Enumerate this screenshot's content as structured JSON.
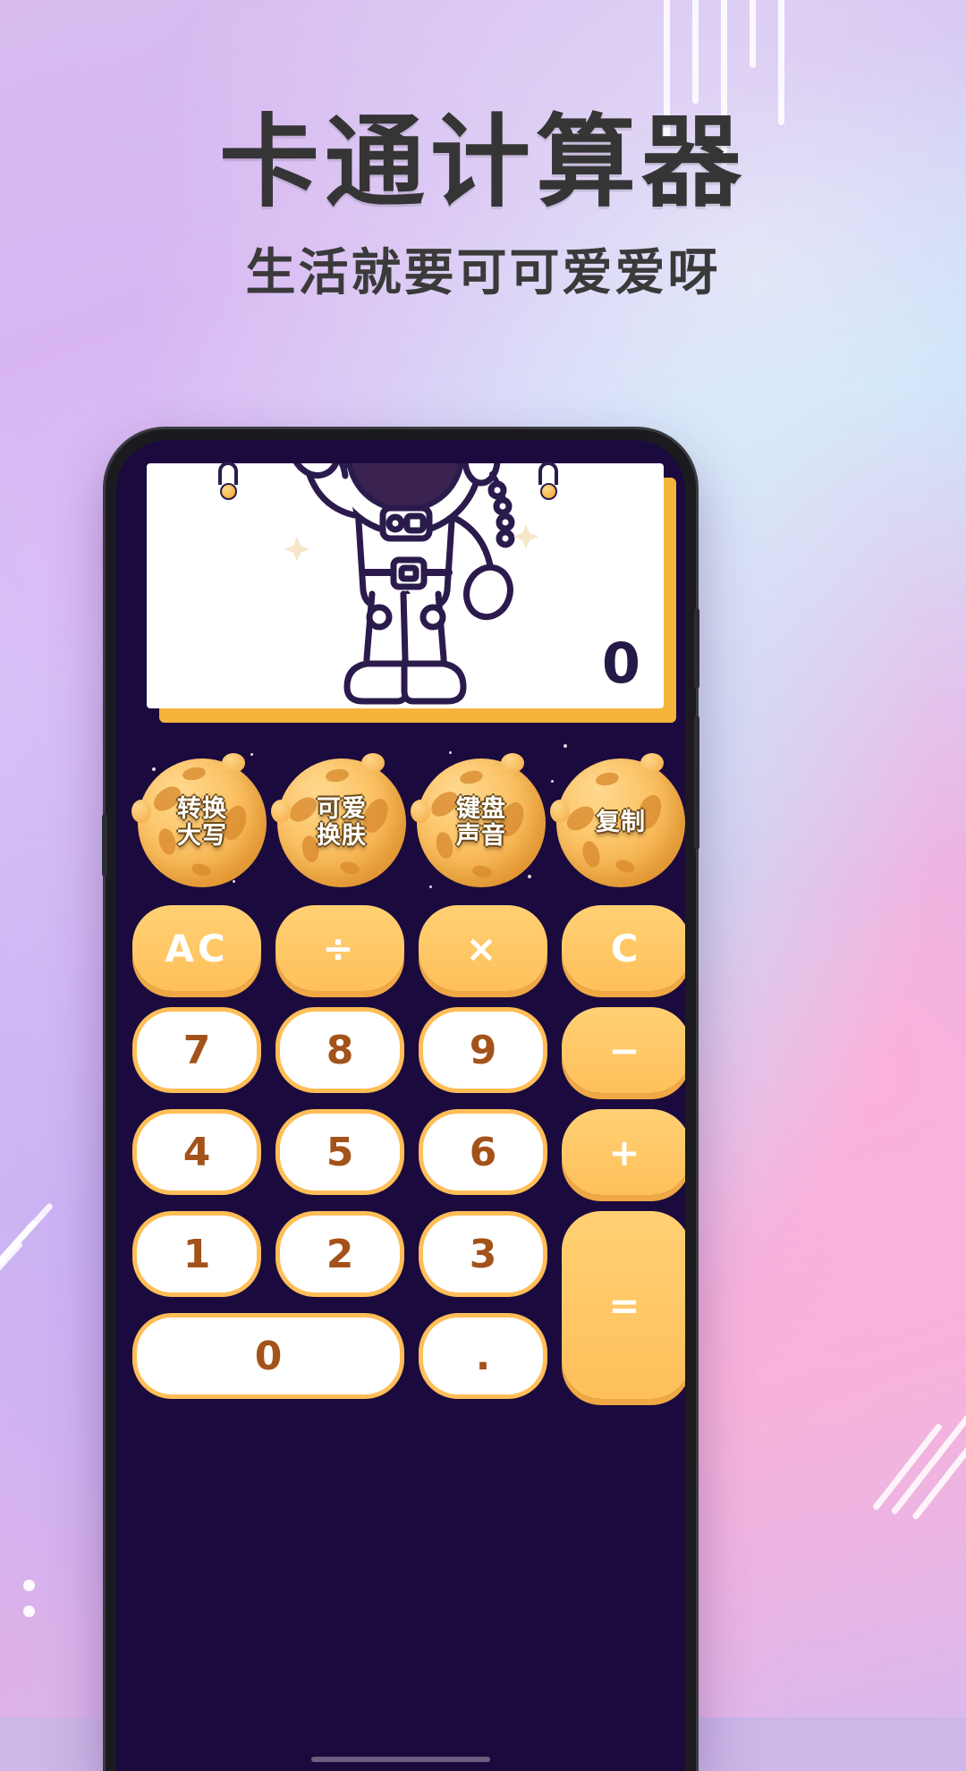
{
  "poster": {
    "title": "卡通计算器",
    "subtitle": "生活就要可可爱爱呀"
  },
  "app": {
    "display": {
      "value": "0"
    },
    "features": [
      {
        "name": "uppercase-convert",
        "line1": "转换",
        "line2": "大写"
      },
      {
        "name": "cute-skin",
        "line1": "可爱",
        "line2": "换肤"
      },
      {
        "name": "keyboard-sound",
        "line1": "键盘",
        "line2": "声音"
      },
      {
        "name": "copy",
        "line1": "复制",
        "line2": ""
      }
    ],
    "keys": {
      "ac": "AC",
      "divide": "÷",
      "multiply": "×",
      "clear": "C",
      "seven": "7",
      "eight": "8",
      "nine": "9",
      "minus": "−",
      "four": "4",
      "five": "5",
      "six": "6",
      "plus": "+",
      "one": "1",
      "two": "2",
      "three": "3",
      "equals": "=",
      "zero": "0",
      "dot": "."
    }
  },
  "colors": {
    "screen_bg": "#1b0a3d",
    "key_orange": "#ffc05b",
    "key_orange_shadow": "#f0a845",
    "key_text_brown": "#a3521a",
    "display_text": "#251a47",
    "moon_orange": "#f5b53d",
    "poster_heading": "#353535"
  }
}
